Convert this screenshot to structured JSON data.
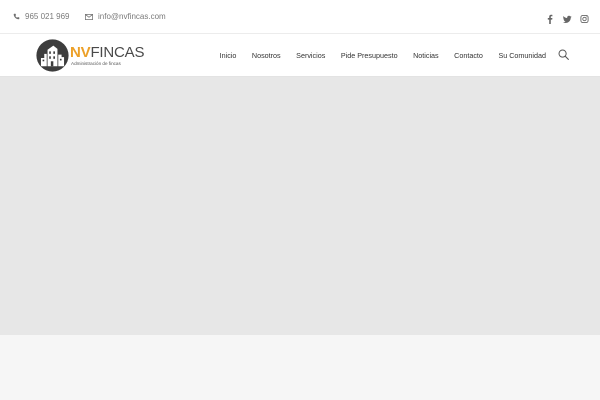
{
  "topbar": {
    "phone": "965 021 969",
    "email": "info@nvfincas.com",
    "social": [
      "facebook-icon",
      "twitter-icon",
      "instagram-icon"
    ]
  },
  "logo": {
    "brand_bold": "NV",
    "brand_rest": "FINCAS",
    "tagline": "Administración de fincas"
  },
  "nav": {
    "items": [
      "Inicio",
      "Nosotros",
      "Servicios",
      "Pide Presupuesto",
      "Noticias",
      "Contacto",
      "Su Comunidad"
    ]
  },
  "colors": {
    "accent": "#eca028",
    "hero_bg": "#e7e7e7",
    "page_bg": "#f6f6f6"
  }
}
